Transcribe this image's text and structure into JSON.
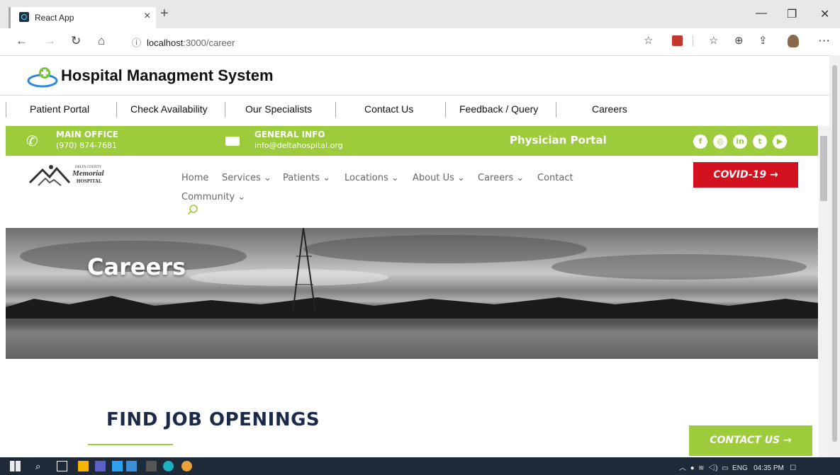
{
  "browser": {
    "tab_title": "React App",
    "url_host": "localhost",
    "url_path": ":3000/career"
  },
  "app": {
    "title": "Hospital Managment System",
    "nav": [
      "Patient Portal",
      "Check Availability",
      "Our Specialists",
      "Contact Us",
      "Feedback / Query",
      "Careers"
    ]
  },
  "topbar": {
    "main_office_label": "MAIN OFFICE",
    "main_office_phone": "(970) 874-7681",
    "general_info_label": "GENERAL INFO",
    "general_info_email": "info@deltahospital.org",
    "physician_portal": "Physician Portal",
    "social": [
      "facebook-icon",
      "instagram-icon",
      "linkedin-icon",
      "twitter-icon",
      "youtube-icon"
    ]
  },
  "site": {
    "logo_line1": "DELTA COUNTY",
    "logo_line2": "Memorial",
    "logo_line3": "HOSPITAL",
    "nav": [
      "Home",
      "Services ⌄",
      "Patients ⌄",
      "Locations ⌄",
      "About Us ⌄",
      "Careers ⌄",
      "Contact",
      "Community ⌄"
    ],
    "covid_button": "COVID-19 →",
    "hero_title": "Careers",
    "section_heading": "FIND JOB OPENINGS",
    "contact_button": "CONTACT US →"
  },
  "taskbar": {
    "lang": "ENG",
    "time": "04:35 PM"
  },
  "colors": {
    "accent_green": "#9ccb3c",
    "covid_red": "#d4111e",
    "heading_navy": "#1b2a4a"
  }
}
